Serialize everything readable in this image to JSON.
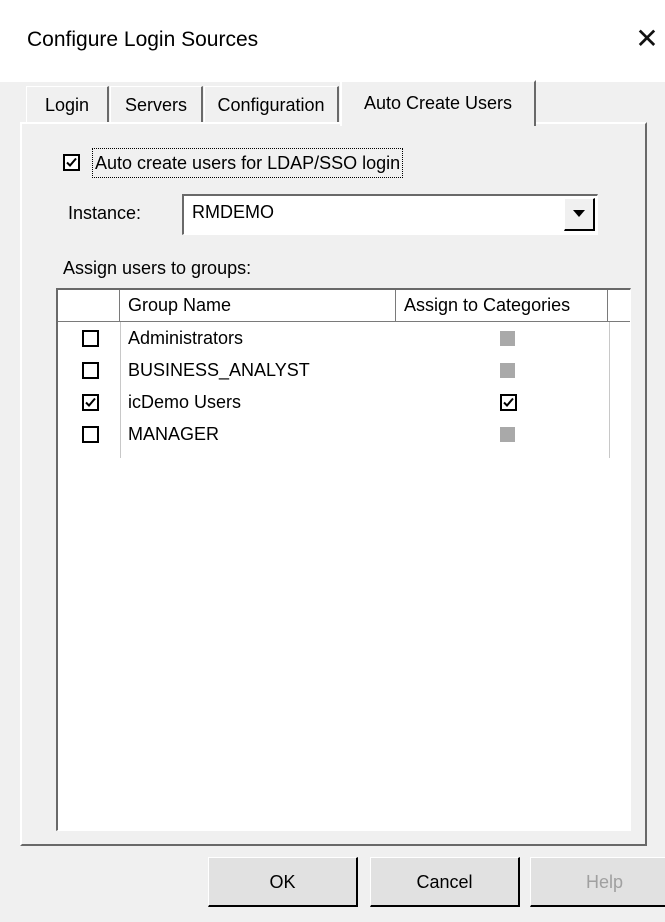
{
  "window": {
    "title": "Configure Login Sources",
    "close_glyph": "✕"
  },
  "tabs": [
    {
      "label": "Login"
    },
    {
      "label": "Servers"
    },
    {
      "label": "Configuration"
    },
    {
      "label": "Auto Create Users",
      "active": true
    }
  ],
  "auto_create": {
    "label": "Auto create users for LDAP/SSO login",
    "checked": true
  },
  "instance": {
    "label": "Instance:",
    "value": "RMDEMO"
  },
  "assign_label": "Assign users to groups:",
  "table": {
    "columns": [
      "Group Name",
      "Assign to Categories"
    ],
    "rows": [
      {
        "name": "Administrators",
        "selected": false,
        "assign_categories": false,
        "assign_enabled": false
      },
      {
        "name": "BUSINESS_ANALYST",
        "selected": false,
        "assign_categories": false,
        "assign_enabled": false
      },
      {
        "name": "icDemo Users",
        "selected": true,
        "assign_categories": true,
        "assign_enabled": true
      },
      {
        "name": "MANAGER",
        "selected": false,
        "assign_categories": false,
        "assign_enabled": false
      }
    ]
  },
  "buttons": {
    "ok": "OK",
    "cancel": "Cancel",
    "help": "Help"
  }
}
